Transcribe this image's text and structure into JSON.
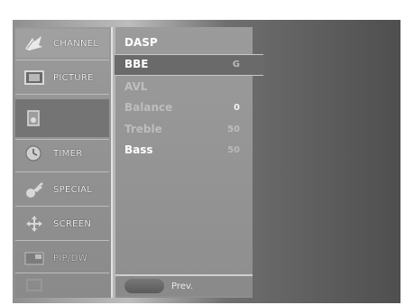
{
  "sidebar": {
    "items": [
      {
        "label": "CHANNEL",
        "icon": "satellite-dish-icon"
      },
      {
        "label": "PICTURE",
        "icon": "picture-frame-icon"
      },
      {
        "label": "",
        "icon": "speaker-icon"
      },
      {
        "label": "TIMER",
        "icon": "clock-icon"
      },
      {
        "label": "SPECIAL",
        "icon": "key-icon"
      },
      {
        "label": "SCREEN",
        "icon": "move-arrows-icon"
      },
      {
        "label": "PIP/DW",
        "icon": "pip-icon"
      },
      {
        "label": "",
        "icon": "blank-icon"
      }
    ]
  },
  "audio_menu": {
    "items": [
      {
        "label": "DASP",
        "value": ""
      },
      {
        "label": "BBE",
        "value": "G"
      },
      {
        "label": "AVL",
        "value": ""
      },
      {
        "label": "Balance",
        "value": "0"
      },
      {
        "label": "Treble",
        "value": "50"
      },
      {
        "label": "Bass",
        "value": "50"
      }
    ]
  },
  "nav": {
    "prev_label": "Prev."
  }
}
